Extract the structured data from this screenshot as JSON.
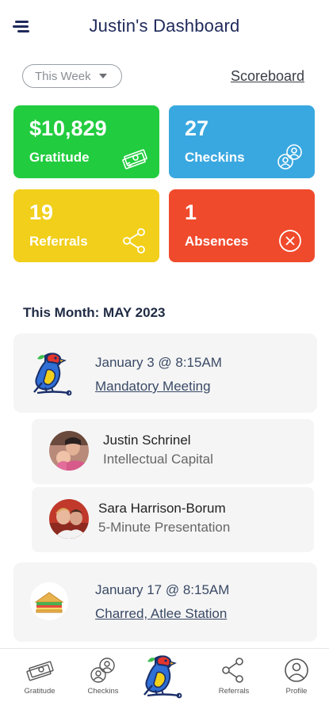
{
  "header": {
    "title": "Justin's Dashboard"
  },
  "filter": {
    "period": "This Week",
    "scoreboard_label": "Scoreboard"
  },
  "stats": [
    {
      "value": "$10,829",
      "label": "Gratitude",
      "color": "#22cc3f",
      "icon": "money-icon"
    },
    {
      "value": "27",
      "label": "Checkins",
      "color": "#3aa8e0",
      "icon": "checkins-icon"
    },
    {
      "value": "19",
      "label": "Referrals",
      "color": "#f2cf1a",
      "icon": "share-icon"
    },
    {
      "value": "1",
      "label": "Absences",
      "color": "#f04a2c",
      "icon": "close-circle-icon"
    }
  ],
  "month_section": {
    "title": "This Month: MAY 2023"
  },
  "events": [
    {
      "date": "January 3 @ 8:15AM",
      "name": "Mandatory Meeting",
      "icon": "bird-logo-icon",
      "presenters": [
        {
          "name": "Justin Schrinel",
          "role": "Intellectual Capital"
        },
        {
          "name": "Sara Harrison-Borum",
          "role": "5-Minute Presentation"
        }
      ]
    },
    {
      "date": "January 17 @ 8:15AM",
      "name": "Charred, Atlee Station",
      "icon": "sandwich-icon"
    }
  ],
  "bottom_nav": [
    {
      "label": "Gratitude",
      "icon": "money-icon"
    },
    {
      "label": "Checkins",
      "icon": "checkins-icon"
    },
    {
      "label": "",
      "icon": "bird-logo-icon"
    },
    {
      "label": "Referrals",
      "icon": "share-icon"
    },
    {
      "label": "Profile",
      "icon": "profile-icon"
    }
  ]
}
